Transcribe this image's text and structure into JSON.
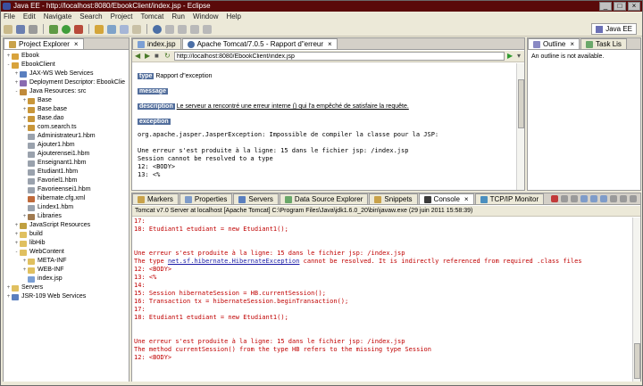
{
  "window": {
    "title": "Java EE - http://localhost:8080/EbookClient/index.jsp - Eclipse",
    "controls": [
      "_",
      "□",
      "×"
    ]
  },
  "menu": [
    "File",
    "Edit",
    "Navigate",
    "Search",
    "Project",
    "Tomcat",
    "Run",
    "Window",
    "Help"
  ],
  "perspective": {
    "label": "Java EE"
  },
  "project_explorer": {
    "tab_label": "Project Explorer",
    "tree": [
      {
        "label": "Ebook",
        "depth": 0,
        "twisty": "+",
        "icon": "project-icon"
      },
      {
        "label": "EbookClient",
        "depth": 0,
        "twisty": "-",
        "icon": "project-icon"
      },
      {
        "label": "JAX-WS Web Services",
        "depth": 1,
        "twisty": "+",
        "icon": "webservice-icon"
      },
      {
        "label": "Deployment Descriptor: EbookClie",
        "depth": 1,
        "twisty": "+",
        "icon": "descriptor-icon"
      },
      {
        "label": "Java Resources: src",
        "depth": 1,
        "twisty": "-",
        "icon": "java-resources-icon"
      },
      {
        "label": "Base",
        "depth": 2,
        "twisty": "+",
        "icon": "package-icon"
      },
      {
        "label": "Base.base",
        "depth": 2,
        "twisty": "+",
        "icon": "package-icon"
      },
      {
        "label": "Base.dao",
        "depth": 2,
        "twisty": "+",
        "icon": "package-icon"
      },
      {
        "label": "com.search.ts",
        "depth": 2,
        "twisty": "+",
        "icon": "package-icon"
      },
      {
        "label": "Administrateur1.hbm",
        "depth": 2,
        "twisty": "",
        "icon": "file-icon"
      },
      {
        "label": "Ajouter1.hbm",
        "depth": 2,
        "twisty": "",
        "icon": "file-icon"
      },
      {
        "label": "Ajouterensei1.hbm",
        "depth": 2,
        "twisty": "",
        "icon": "file-icon"
      },
      {
        "label": "Enseignant1.hbm",
        "depth": 2,
        "twisty": "",
        "icon": "file-icon"
      },
      {
        "label": "Etudiant1.hbm",
        "depth": 2,
        "twisty": "",
        "icon": "file-icon"
      },
      {
        "label": "Favoriel1.hbm",
        "depth": 2,
        "twisty": "",
        "icon": "file-icon"
      },
      {
        "label": "Favorieensei1.hbm",
        "depth": 2,
        "twisty": "",
        "icon": "file-icon"
      },
      {
        "label": "hibernate.cfg.xml",
        "depth": 2,
        "twisty": "",
        "icon": "xml-file-icon"
      },
      {
        "label": "Lindex1.hbm",
        "depth": 2,
        "twisty": "",
        "icon": "file-icon"
      },
      {
        "label": "Libraries",
        "depth": 2,
        "twisty": "+",
        "icon": "library-icon"
      },
      {
        "label": "JavaScript Resources",
        "depth": 1,
        "twisty": "+",
        "icon": "js-resources-icon"
      },
      {
        "label": "build",
        "depth": 1,
        "twisty": "+",
        "icon": "folder-icon"
      },
      {
        "label": "libHib",
        "depth": 1,
        "twisty": "+",
        "icon": "folder-icon"
      },
      {
        "label": "WebContent",
        "depth": 1,
        "twisty": "-",
        "icon": "folder-icon"
      },
      {
        "label": "META-INF",
        "depth": 2,
        "twisty": "+",
        "icon": "folder-icon"
      },
      {
        "label": "WEB-INF",
        "depth": 2,
        "twisty": "+",
        "icon": "folder-icon"
      },
      {
        "label": "index.jsp",
        "depth": 2,
        "twisty": "",
        "icon": "jsp-file-icon"
      },
      {
        "label": "Servers",
        "depth": 0,
        "twisty": "+",
        "icon": "servers-folder-icon"
      },
      {
        "label": "JSR-109 Web Services",
        "depth": 0,
        "twisty": "+",
        "icon": "webservice-icon"
      }
    ]
  },
  "editor": {
    "tabs": [
      {
        "label": "index.jsp",
        "active": false
      },
      {
        "label": "Apache Tomcat/7.0.5 - Rapport d\"erreur",
        "active": true
      }
    ],
    "url": "http://localhost:8080/EbookClient/index.jsp",
    "page": {
      "h_type": "type",
      "type_value": "Rapport d\"exception",
      "h_message": "message",
      "h_description": "description",
      "description_value": "Le serveur a rencontré une erreur interne () qui l'a empêché de satisfaire la requête.",
      "h_exception": "exception",
      "exception_lines": [
        "org.apache.jasper.JasperException: Impossible de compiler la classe pour la JSP:",
        "",
        "Une erreur s'est produite à la ligne: 15 dans le fichier jsp: /index.jsp",
        "Session cannot be resolved to a type",
        "12: <BODY>",
        "13: <%"
      ]
    }
  },
  "outline": {
    "tabs": [
      {
        "label": "Outline"
      },
      {
        "label": "Task Lis"
      }
    ],
    "message": "An outline is not available."
  },
  "console": {
    "tabs": [
      {
        "label": "Markers",
        "active": false
      },
      {
        "label": "Properties",
        "active": false
      },
      {
        "label": "Servers",
        "active": false
      },
      {
        "label": "Data Source Explorer",
        "active": false
      },
      {
        "label": "Snippets",
        "active": false
      },
      {
        "label": "Console",
        "active": true
      },
      {
        "label": "TCP/IP Monitor",
        "active": false
      }
    ],
    "header": "Tomcat v7.0 Server at localhost [Apache Tomcat] C:\\Program Files\\Java\\jdk1.6.0_20\\bin\\javaw.exe (29 juin 2011 15:58:39)",
    "lines": [
      {
        "text": "17:"
      },
      {
        "text": "18: Etudiant1 etudiant = new Etudiant1();"
      },
      {
        "text": ""
      },
      {
        "text": ""
      },
      {
        "text": "Une erreur s'est produite à la ligne: 15 dans le fichier jsp: /index.jsp"
      },
      {
        "text": "The type ",
        "link": "net.sf.hibernate.HibernateException",
        "after": " cannot be resolved. It is indirectly referenced from required .class files"
      },
      {
        "text": "12: <BODY>"
      },
      {
        "text": "13: <%"
      },
      {
        "text": "14:"
      },
      {
        "text": "15: Session hibernateSession = HB.currentSession();"
      },
      {
        "text": "16: Transaction tx = hibernateSession.beginTransaction();"
      },
      {
        "text": "17:"
      },
      {
        "text": "18: Etudiant1 etudiant = new Etudiant1();"
      },
      {
        "text": ""
      },
      {
        "text": ""
      },
      {
        "text": "Une erreur s'est produite à la ligne: 15 dans le fichier jsp: /index.jsp"
      },
      {
        "text": "The method currentSession() from the type HB refers to the missing type Session"
      },
      {
        "text": "12: <BODY>"
      }
    ]
  },
  "colors": {
    "title_bar": "#5a0a0a",
    "error_text": "#c00000",
    "link": "#1a1aa6",
    "html_header_box": "#526e9c"
  }
}
